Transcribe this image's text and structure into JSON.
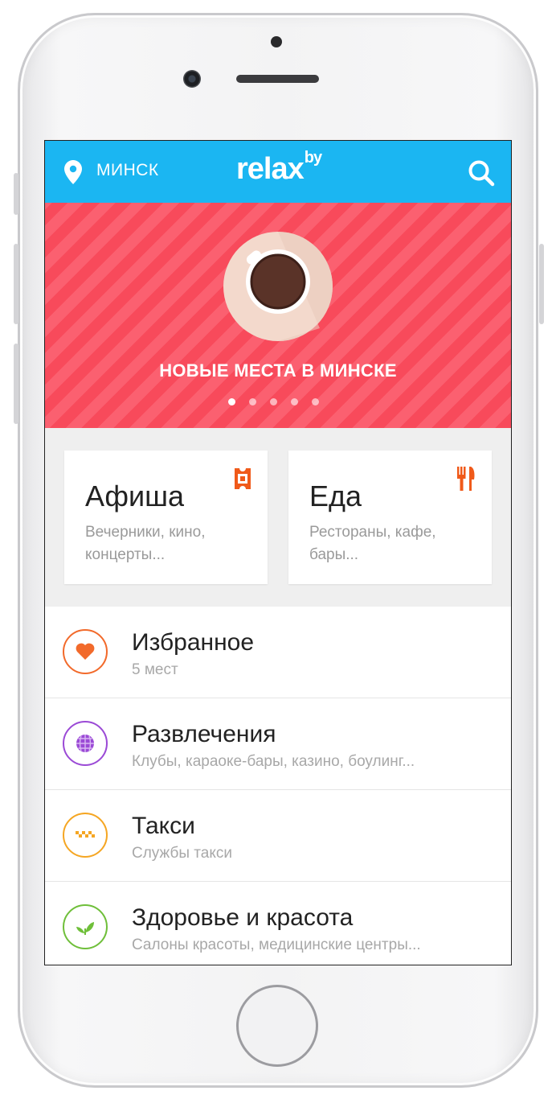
{
  "header": {
    "city": "МИНСК",
    "logo_main": "relax",
    "logo_sup": "by"
  },
  "banner": {
    "title": "НОВЫЕ МЕСТА В МИНСКЕ",
    "slide_count": 5,
    "active_slide": 1,
    "colors": {
      "stripe_a": "#f84a5b",
      "stripe_b": "#fb6070"
    }
  },
  "cards": [
    {
      "title": "Афиша",
      "subtitle": "Вечерники, кино, концерты...",
      "icon": "ticket-icon",
      "icon_color": "#f05a1a"
    },
    {
      "title": "Еда",
      "subtitle": "Рестораны, кафе, бары...",
      "icon": "fork-knife-icon",
      "icon_color": "#f05a1a"
    }
  ],
  "list": [
    {
      "title": "Избранное",
      "subtitle": "5 мест",
      "icon": "heart-icon",
      "color": "#f26a2b"
    },
    {
      "title": "Развлечения",
      "subtitle": "Клубы, караоке-бары, казино, боулинг...",
      "icon": "disco-ball-icon",
      "color": "#9b4ad6"
    },
    {
      "title": "Такси",
      "subtitle": "Службы такси",
      "icon": "taxi-checker-icon",
      "color": "#f5a623"
    },
    {
      "title": "Здоровье и красота",
      "subtitle": "Салоны красоты, медицинские центры...",
      "icon": "leaf-icon",
      "color": "#6fbf3a"
    }
  ],
  "theme": {
    "accent": "#1bb6f2"
  }
}
